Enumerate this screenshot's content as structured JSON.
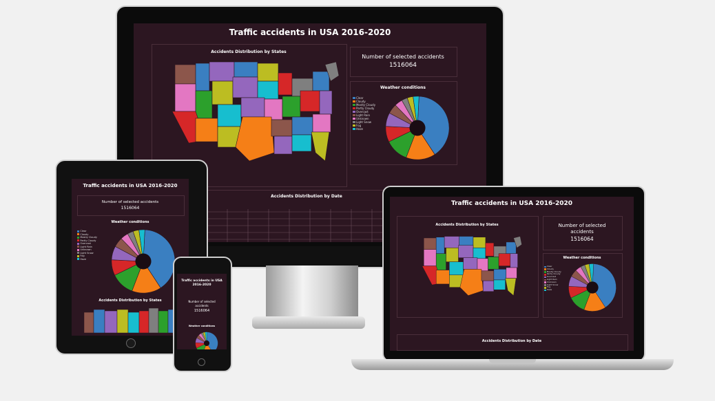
{
  "dashboard": {
    "title": "Traffic accidents in USA 2016-2020",
    "title_short_line1": "Traffic accidents in USA",
    "title_short_line2": "2016-2020",
    "map_title": "Accidents Distribution by States",
    "count_title": "Number of selected accidents",
    "count_title_line1": "Number of selected",
    "count_title_line2": "accidents",
    "count_value": "1516064",
    "weather_title": "Weather conditions",
    "date_title": "Accidents Distribution by Date"
  },
  "weather_legend": [
    {
      "label": "Clear",
      "color": "#3a7fc1"
    },
    {
      "label": "Cloudy",
      "color": "#f57f17"
    },
    {
      "label": "Mostly Cloudy",
      "color": "#2ca02c"
    },
    {
      "label": "Partly Cloudy",
      "color": "#d62728"
    },
    {
      "label": "Overcast",
      "color": "#9467bd"
    },
    {
      "label": "Light Rain",
      "color": "#8c564b"
    },
    {
      "label": "Unknown",
      "color": "#e377c2"
    },
    {
      "label": "Light Snow",
      "color": "#7f7f7f"
    },
    {
      "label": "Fog",
      "color": "#bcbd22"
    },
    {
      "label": "Haze",
      "color": "#17becf"
    }
  ],
  "weather_shares": [
    0.4,
    0.15,
    0.12,
    0.08,
    0.07,
    0.05,
    0.04,
    0.03,
    0.03,
    0.03
  ],
  "colors": {
    "dashboard_bg": "#2c1621",
    "page_bg": "#f1f1f1"
  }
}
